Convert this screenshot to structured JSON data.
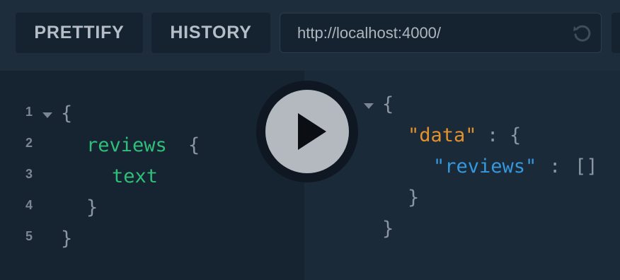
{
  "toolbar": {
    "prettify_label": "PRETTIFY",
    "history_label": "HISTORY",
    "url": "http://localhost:4000/",
    "reload_icon": "reload-icon"
  },
  "editor": {
    "line_numbers": [
      "1",
      "2",
      "3",
      "4",
      "5"
    ],
    "lines": [
      {
        "tokens": [
          {
            "text": "{",
            "kind": "brace"
          }
        ]
      },
      {
        "tokens": [
          {
            "text": "reviews",
            "kind": "field"
          },
          {
            "text": "{",
            "kind": "brace"
          }
        ]
      },
      {
        "tokens": [
          {
            "text": "text",
            "kind": "field"
          }
        ]
      },
      {
        "tokens": [
          {
            "text": "}",
            "kind": "brace"
          }
        ]
      },
      {
        "tokens": [
          {
            "text": "}",
            "kind": "brace"
          }
        ]
      }
    ]
  },
  "execute": {
    "icon": "play-icon"
  },
  "result": {
    "open_brace": "{",
    "data_key": "\"data\"",
    "colon1": ":",
    "data_open": "{",
    "reviews_key": "\"reviews\"",
    "colon2": ":",
    "reviews_value": "[]",
    "data_close": "}",
    "close_brace": "}"
  },
  "colors": {
    "field": "#2fbf7a",
    "key_orange": "#e2912d",
    "key_blue": "#3598dd",
    "brace": "#8a96a2"
  }
}
